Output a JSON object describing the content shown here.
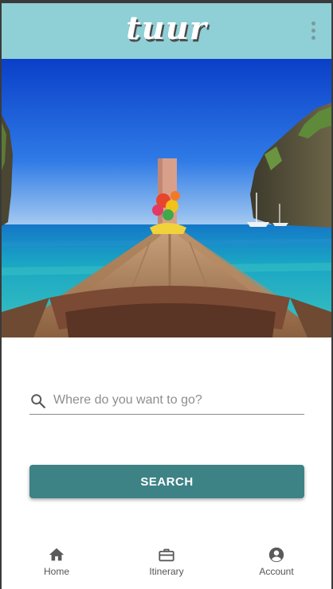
{
  "app": {
    "logo_text": "tuur"
  },
  "colors": {
    "appbar": "#8fcfd6",
    "accent": "#3d8285",
    "nav_icon": "#5a5a5a"
  },
  "icons": {
    "menu": "more-vert-icon",
    "search": "search-icon",
    "home": "home-icon",
    "itinerary": "briefcase-icon",
    "account": "account-circle-icon"
  },
  "search": {
    "placeholder": "Where do you want to go?",
    "value": "",
    "button_label": "SEARCH"
  },
  "nav": {
    "items": [
      {
        "label": "Home"
      },
      {
        "label": "Itinerary"
      },
      {
        "label": "Account"
      }
    ]
  }
}
